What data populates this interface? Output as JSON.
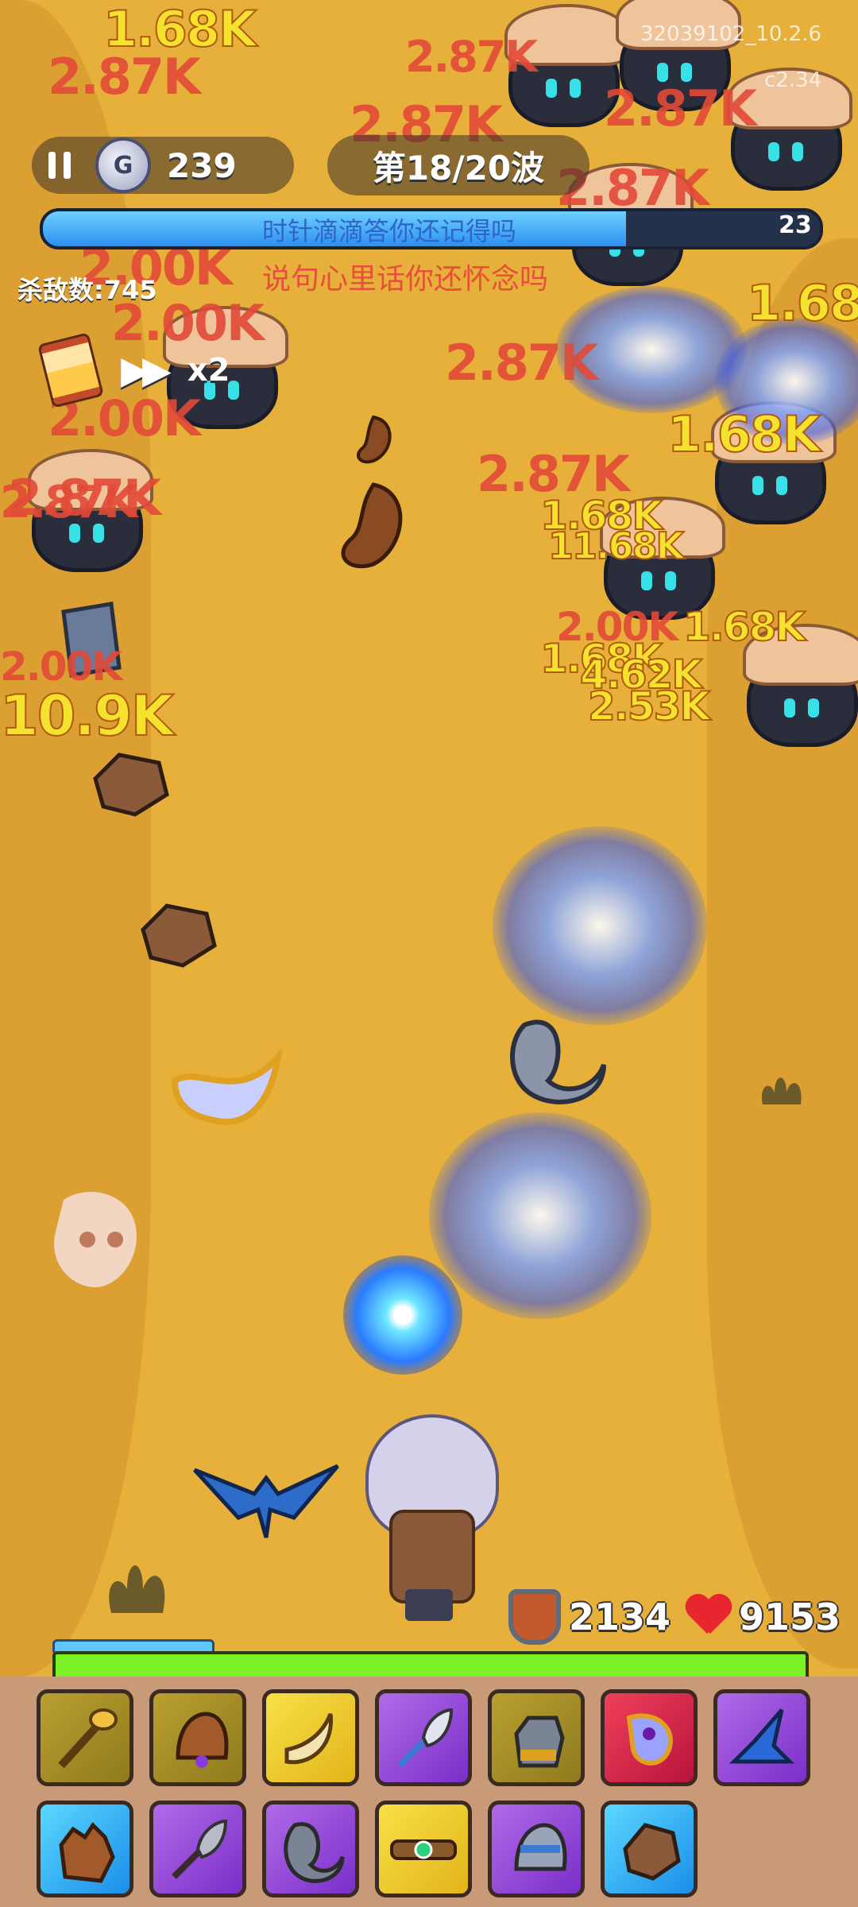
{
  "hud": {
    "coins": "239",
    "coin_symbol": "G",
    "wave": "第18/20波",
    "boss_name": "时针滴滴答你还记得吗",
    "boss_count": "23",
    "kills": "杀敌数:745",
    "subtitle": "说句心里话你还怀念吗",
    "speed": "x2",
    "watermark": "32039102_10.2.6",
    "watermark2": "c2.34"
  },
  "player": {
    "defense": "2134",
    "health": "9153",
    "xp_fraction": 0.21,
    "hp_fraction": 1.0
  },
  "damage_numbers": [
    "1.68K",
    "2.87K",
    "2.87K",
    "2.87K",
    "2.87K",
    "2.87K",
    "2.00K",
    "2.00K",
    "2.00K",
    "2.87K",
    "2.87K",
    "1.68K",
    "1.68K",
    "1.68K",
    "1.68K",
    "11.68K",
    "2.87K",
    "10.9K",
    "2.00K",
    "1.68K",
    "4.62K",
    "2.53K",
    "2.00K",
    "2.87K"
  ],
  "skills_row1": [
    "golden-staff",
    "bell",
    "horn",
    "feather-wand",
    "gauntlet",
    "amulet",
    "wizard-hat"
  ],
  "skills_row2": [
    "leather-glove",
    "quill-sword",
    "moon-charm",
    "belt",
    "silver-bell",
    "stone"
  ],
  "colors": {
    "boss_bar": "#2c8ff0",
    "hp_bar": "#7bf226",
    "xp_bar": "#5fc7ff",
    "damage_red": "#e24a38",
    "damage_yellow": "#f4e22e"
  }
}
